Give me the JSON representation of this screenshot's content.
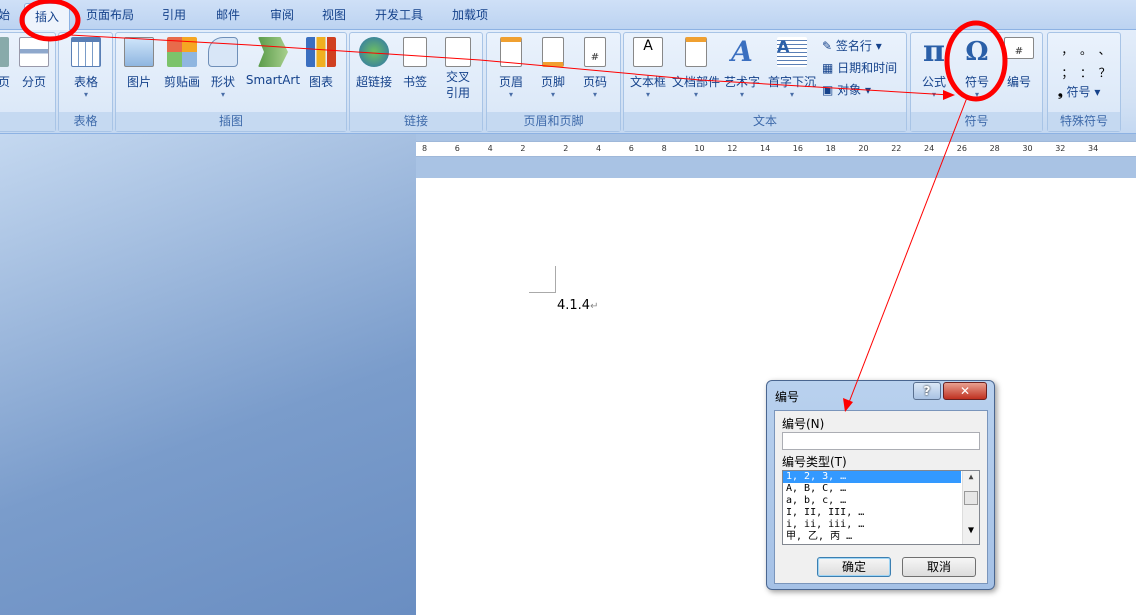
{
  "tabs": [
    "始",
    "插入",
    "页面布局",
    "引用",
    "邮件",
    "审阅",
    "视图",
    "开发工具",
    "加载项"
  ],
  "active_tab": "插入",
  "groups": {
    "pages": {
      "buttons": [
        "页",
        "分页"
      ]
    },
    "table": {
      "label": "表格",
      "buttons": [
        "表格"
      ]
    },
    "illustrations": {
      "label": "插图",
      "buttons": [
        "图片",
        "剪贴画",
        "形状",
        "SmartArt",
        "图表"
      ]
    },
    "links": {
      "label": "链接",
      "buttons": [
        "超链接",
        "书签",
        "交叉引用"
      ]
    },
    "header_footer": {
      "label": "页眉和页脚",
      "buttons": [
        "页眉",
        "页脚",
        "页码"
      ]
    },
    "text": {
      "label": "文本",
      "buttons": [
        "文本框",
        "文档部件",
        "艺术字",
        "首字下沉"
      ],
      "small": [
        "签名行",
        "日期和时间",
        "对象"
      ]
    },
    "symbols": {
      "label": "符号",
      "buttons": [
        "公式",
        "符号",
        "编号"
      ]
    },
    "special": {
      "label": "特殊符号",
      "glyphs": [
        "，",
        "。",
        "、",
        "；",
        "：",
        "？"
      ],
      "button": "符号"
    }
  },
  "ruler": [
    "8",
    "6",
    "4",
    "2",
    "2",
    "4",
    "6",
    "8",
    "10",
    "12",
    "14",
    "16",
    "18",
    "20",
    "22",
    "24",
    "26",
    "28",
    "30",
    "32",
    "34"
  ],
  "document": {
    "text": "4.1.4"
  },
  "dialog": {
    "title": "编号",
    "number_label": "编号(N)",
    "number_value": "",
    "type_label": "编号类型(T)",
    "types": [
      "1, 2, 3, …",
      "A, B, C, …",
      "a, b, c, …",
      "I, II, III, …",
      "i, ii, iii, …",
      "甲, 乙, 丙 …"
    ],
    "selected": "1, 2, 3, …",
    "ok": "确定",
    "cancel": "取消",
    "help": "?",
    "close": "✕"
  },
  "colors": {
    "annotation": "#ff0000",
    "selection": "#3399ff"
  }
}
